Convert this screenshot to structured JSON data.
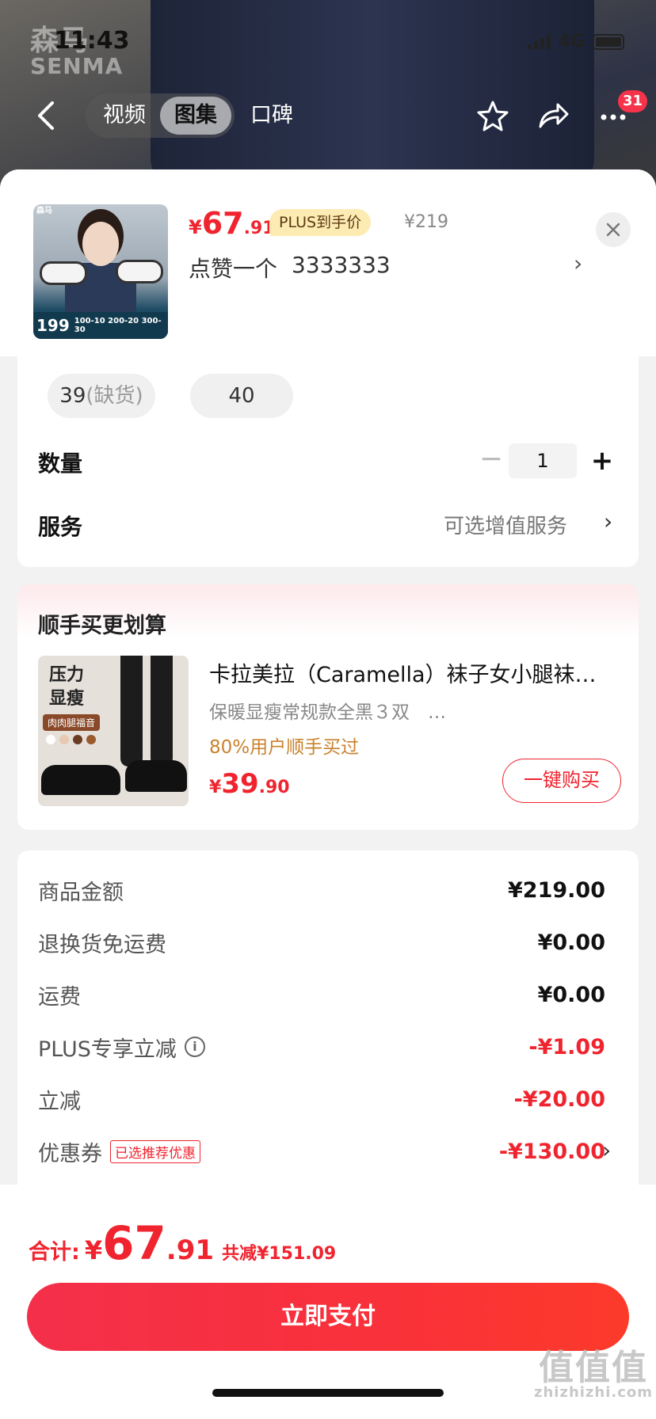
{
  "status_bar": {
    "time": "11:43",
    "network": "4G"
  },
  "brand": {
    "logo_cn": "森马",
    "logo_en": "SENMA"
  },
  "nav": {
    "tabs": [
      "视频",
      "图集"
    ],
    "tab_extra": "口碑",
    "notification_count": "31"
  },
  "product": {
    "price_yen": "¥",
    "price_int": "67",
    "price_dec": ".91",
    "plus_tag": "PLUS到手价",
    "original_price": "¥219",
    "variant_name": "点赞一个",
    "variant_value": "3333333",
    "thumb": {
      "logo": "森马",
      "promo": "199",
      "deals": "100-10 200-20 300-30"
    }
  },
  "sizes": [
    {
      "label": "39",
      "note": "(缺货)"
    },
    {
      "label": "40",
      "note": ""
    }
  ],
  "quantity": {
    "label": "数量",
    "value": "1",
    "minus": "−",
    "plus": "+"
  },
  "service": {
    "label": "服务",
    "value": "可选增值服务"
  },
  "addon": {
    "section_title": "顺手买更划算",
    "thumb_text": "压力\n显瘦",
    "thumb_tag": "肉肉腿福音",
    "name": "卡拉美拉（Caramella）袜子女小腿袜…",
    "desc": "保暖显瘦常规款全黑３双　…",
    "stat": "80%用户顺手买过",
    "price_yen": "¥",
    "price_int": "39",
    "price_dec": ".90",
    "buy_label": "一键购买"
  },
  "summary": [
    {
      "label": "商品金额",
      "value": "¥219.00",
      "red": false
    },
    {
      "label": "退换货免运费",
      "value": "¥0.00",
      "red": false
    },
    {
      "label": "运费",
      "value": "¥0.00",
      "red": false
    },
    {
      "label": "PLUS专享立减",
      "value": "-¥1.09",
      "red": true
    },
    {
      "label": "立减",
      "value": "-¥20.00",
      "red": true
    },
    {
      "label": "优惠券",
      "value": "-¥130.00",
      "red": true,
      "tag": "已选推荐优惠"
    }
  ],
  "total": {
    "label": "合计:",
    "yen": "¥",
    "int": "67",
    "dec": ".91",
    "saved": "共减¥151.09"
  },
  "pay_button": "立即支付",
  "watermark": {
    "cn": "值值值",
    "en": "zhizhizhi.com"
  },
  "colors": {
    "accent": "#f0242f",
    "plus_tag_bg": "#fdebb4"
  }
}
